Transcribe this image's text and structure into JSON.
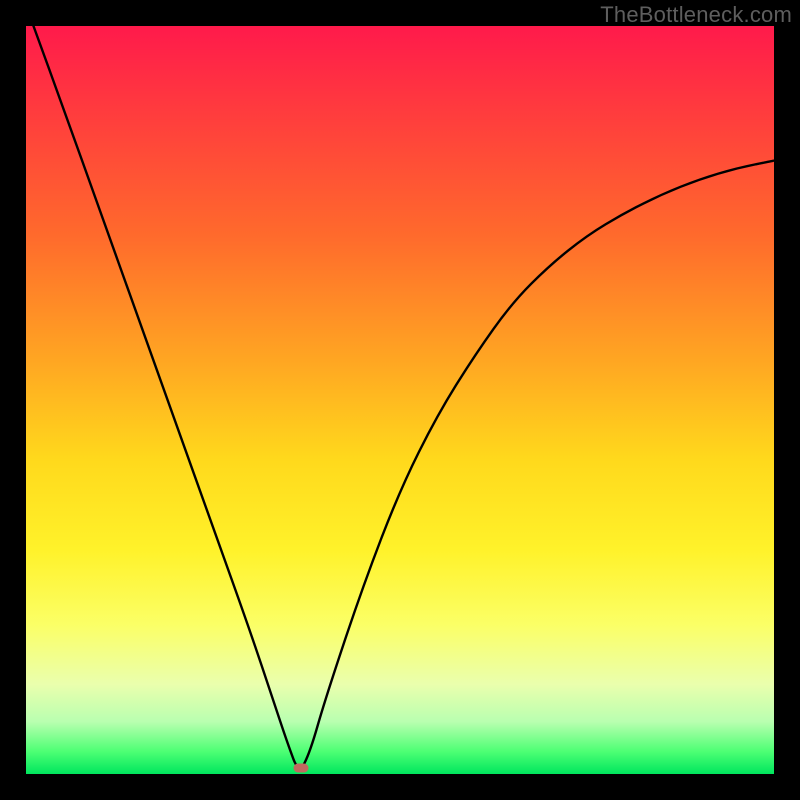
{
  "watermark": "TheBottleneck.com",
  "chart_data": {
    "type": "line",
    "title": "",
    "xlabel": "",
    "ylabel": "",
    "xlim": [
      0,
      100
    ],
    "ylim": [
      0,
      100
    ],
    "grid": false,
    "series": [
      {
        "name": "bottleneck-curve",
        "x": [
          1,
          5,
          10,
          15,
          20,
          25,
          30,
          33,
          35,
          36.5,
          38,
          40,
          45,
          50,
          55,
          60,
          65,
          70,
          75,
          80,
          85,
          90,
          95,
          100
        ],
        "values": [
          100,
          89,
          75,
          61,
          47,
          33,
          19,
          10,
          4,
          0,
          3,
          10,
          25,
          38,
          48,
          56,
          63,
          68,
          72,
          75,
          77.5,
          79.5,
          81,
          82
        ]
      }
    ],
    "annotations": [
      {
        "name": "optimum-marker",
        "x": 36.8,
        "y": 0.8
      }
    ],
    "background_gradient": {
      "top_color": "#ff1a4b",
      "bottom_color": "#00e65e"
    }
  }
}
